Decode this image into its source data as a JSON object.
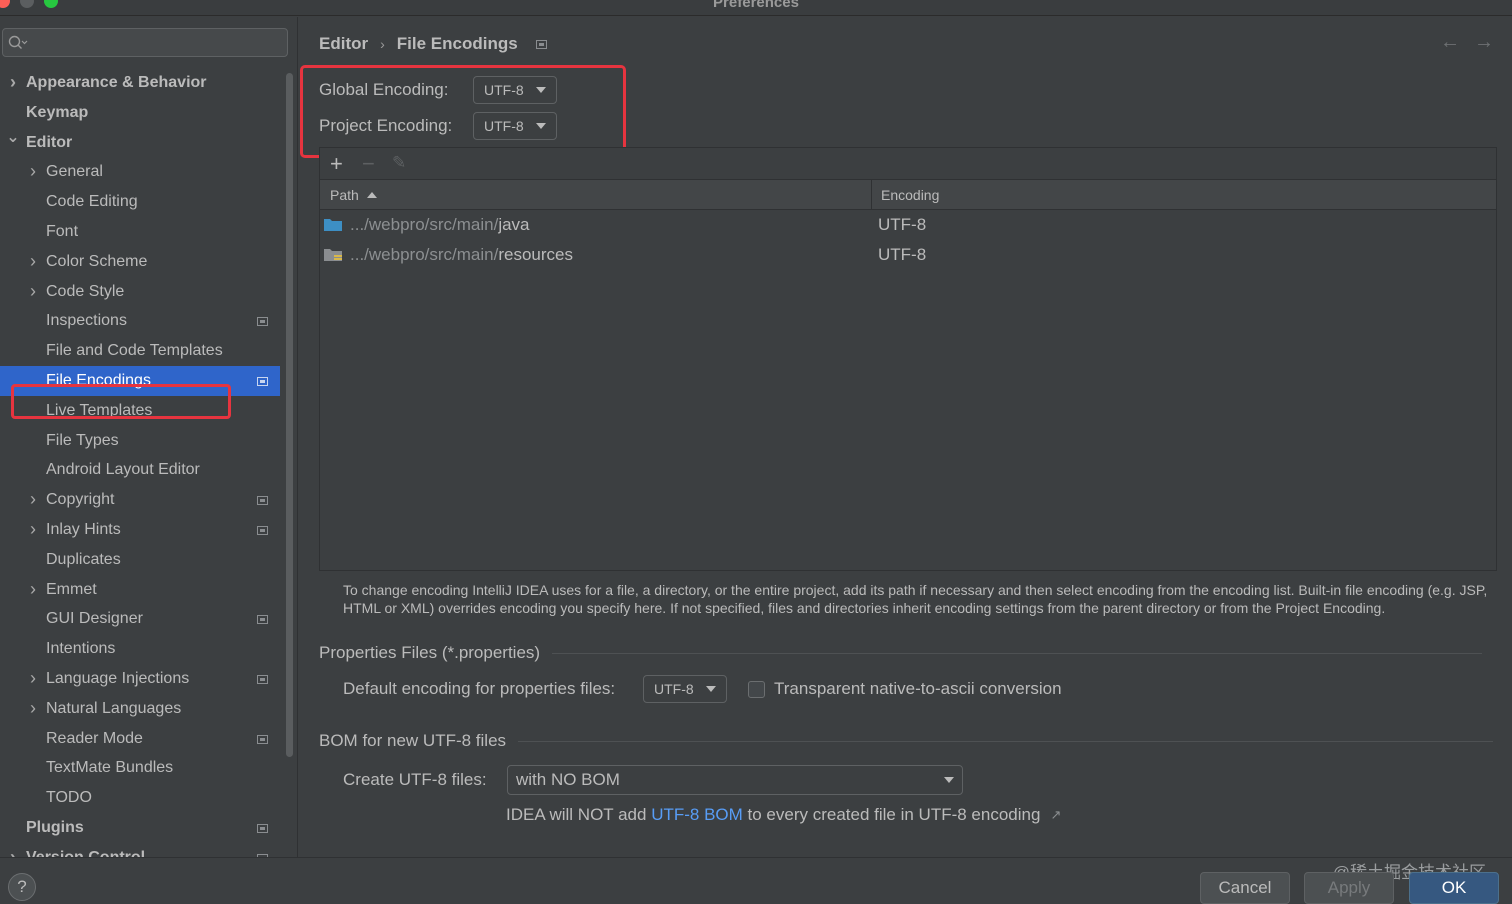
{
  "window": {
    "title": "Preferences"
  },
  "sidebar": {
    "search_placeholder": "",
    "items": [
      {
        "label": "Appearance & Behavior",
        "level": 0,
        "chevron": "right",
        "bold": true,
        "project_icon": false
      },
      {
        "label": "Keymap",
        "level": 0,
        "chevron": "",
        "bold": true,
        "project_icon": false
      },
      {
        "label": "Editor",
        "level": 0,
        "chevron": "down",
        "bold": true,
        "project_icon": false
      },
      {
        "label": "General",
        "level": 1,
        "chevron": "right",
        "bold": false,
        "project_icon": false
      },
      {
        "label": "Code Editing",
        "level": 1,
        "chevron": "",
        "bold": false,
        "project_icon": false
      },
      {
        "label": "Font",
        "level": 1,
        "chevron": "",
        "bold": false,
        "project_icon": false
      },
      {
        "label": "Color Scheme",
        "level": 1,
        "chevron": "right",
        "bold": false,
        "project_icon": false
      },
      {
        "label": "Code Style",
        "level": 1,
        "chevron": "right",
        "bold": false,
        "project_icon": false
      },
      {
        "label": "Inspections",
        "level": 1,
        "chevron": "",
        "bold": false,
        "project_icon": true
      },
      {
        "label": "File and Code Templates",
        "level": 1,
        "chevron": "",
        "bold": false,
        "project_icon": false
      },
      {
        "label": "File Encodings",
        "level": 1,
        "chevron": "",
        "bold": false,
        "project_icon": true,
        "selected": true
      },
      {
        "label": "Live Templates",
        "level": 1,
        "chevron": "",
        "bold": false,
        "project_icon": false
      },
      {
        "label": "File Types",
        "level": 1,
        "chevron": "",
        "bold": false,
        "project_icon": false
      },
      {
        "label": "Android Layout Editor",
        "level": 1,
        "chevron": "",
        "bold": false,
        "project_icon": false
      },
      {
        "label": "Copyright",
        "level": 1,
        "chevron": "right",
        "bold": false,
        "project_icon": true
      },
      {
        "label": "Inlay Hints",
        "level": 1,
        "chevron": "right",
        "bold": false,
        "project_icon": true
      },
      {
        "label": "Duplicates",
        "level": 1,
        "chevron": "",
        "bold": false,
        "project_icon": false
      },
      {
        "label": "Emmet",
        "level": 1,
        "chevron": "right",
        "bold": false,
        "project_icon": false
      },
      {
        "label": "GUI Designer",
        "level": 1,
        "chevron": "",
        "bold": false,
        "project_icon": true
      },
      {
        "label": "Intentions",
        "level": 1,
        "chevron": "",
        "bold": false,
        "project_icon": false
      },
      {
        "label": "Language Injections",
        "level": 1,
        "chevron": "right",
        "bold": false,
        "project_icon": true
      },
      {
        "label": "Natural Languages",
        "level": 1,
        "chevron": "right",
        "bold": false,
        "project_icon": false
      },
      {
        "label": "Reader Mode",
        "level": 1,
        "chevron": "",
        "bold": false,
        "project_icon": true
      },
      {
        "label": "TextMate Bundles",
        "level": 1,
        "chevron": "",
        "bold": false,
        "project_icon": false
      },
      {
        "label": "TODO",
        "level": 1,
        "chevron": "",
        "bold": false,
        "project_icon": false
      },
      {
        "label": "Plugins",
        "level": 0,
        "chevron": "",
        "bold": true,
        "project_icon": true
      },
      {
        "label": "Version Control",
        "level": 0,
        "chevron": "right",
        "bold": true,
        "project_icon": true
      }
    ]
  },
  "breadcrumb": {
    "parent": "Editor",
    "separator": "›",
    "current": "File Encodings"
  },
  "encodings": {
    "global_label": "Global Encoding:",
    "global_value": "UTF-8",
    "project_label": "Project Encoding:",
    "project_value": "UTF-8"
  },
  "table": {
    "toolbar": {
      "add": "+",
      "remove": "−",
      "edit": "✎"
    },
    "columns": {
      "path": "Path",
      "encoding": "Encoding"
    },
    "rows": [
      {
        "path_prefix": ".../webpro/src/main/",
        "path_leaf": "java",
        "encoding": "UTF-8",
        "icon": "folder-icon"
      },
      {
        "path_prefix": ".../webpro/src/main/",
        "path_leaf": "resources",
        "encoding": "UTF-8",
        "icon": "resources-folder-icon"
      }
    ]
  },
  "help_text": "To change encoding IntelliJ IDEA uses for a file, a directory, or the entire project, add its path if necessary and then select encoding from the encoding list. Built-in file encoding (e.g. JSP, HTML or XML) overrides encoding you specify here. If not specified, files and directories inherit encoding settings from the parent directory or from the Project Encoding.",
  "properties": {
    "section_title": "Properties Files (*.properties)",
    "default_label": "Default encoding for properties files:",
    "default_value": "UTF-8",
    "transparent_label": "Transparent native-to-ascii conversion"
  },
  "bom": {
    "section_title": "BOM for new UTF-8 files",
    "create_label": "Create UTF-8 files:",
    "create_value": "with NO BOM",
    "note_prefix": "IDEA will NOT add ",
    "note_link": "UTF-8 BOM",
    "note_suffix": " to every created file in UTF-8 encoding",
    "note_arrow": "↗"
  },
  "footer": {
    "help": "?",
    "cancel": "Cancel",
    "apply": "Apply",
    "ok": "OK",
    "watermark": "@稀土掘金技术社区"
  },
  "colors": {
    "accent": "#2f65ca",
    "highlight_box": "#e6343f",
    "link": "#589df6"
  }
}
